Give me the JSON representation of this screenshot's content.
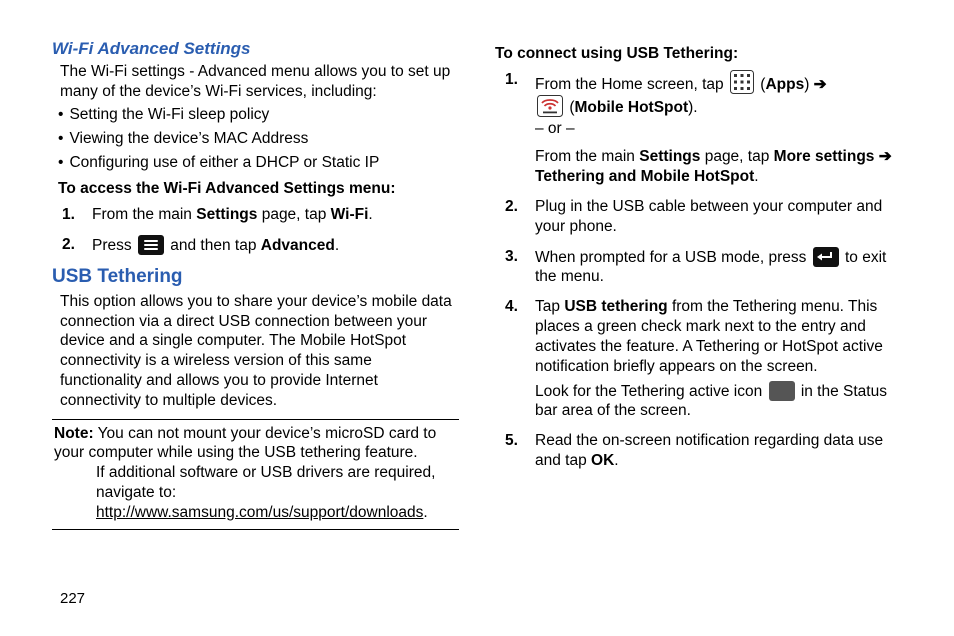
{
  "page_number": "227",
  "left": {
    "heading_wifi": "Wi-Fi Advanced Settings",
    "wifi_intro": "The Wi-Fi settings - Advanced menu allows you to set up many of the device’s Wi-Fi services, including:",
    "wifi_bullets": [
      "Setting the Wi-Fi sleep policy",
      "Viewing the device’s MAC Address",
      "Configuring use of either a DHCP or Static IP"
    ],
    "wifi_access_heading": "To access the Wi-Fi Advanced Settings menu:",
    "wifi_step1_pre": "From the main ",
    "wifi_step1_b1": "Settings",
    "wifi_step1_mid": " page, tap ",
    "wifi_step1_b2": "Wi-Fi",
    "wifi_step1_post": ".",
    "wifi_step2_pre": "Press ",
    "wifi_step2_mid": " and then tap ",
    "wifi_step2_b": "Advanced",
    "wifi_step2_post": ".",
    "heading_usb": "USB Tethering",
    "usb_intro": "This option allows you to share your device’s mobile data connection via a direct USB connection between your device and a single computer. The Mobile HotSpot connectivity is a wireless version of this same functionality and allows you to provide Internet connectivity to multiple devices.",
    "note_label": "Note:",
    "note_line1": " You can not mount your device’s microSD card to your computer while using the USB tethering feature.",
    "note_line2_pre": "If additional software or USB drivers are required, navigate to: ",
    "note_link": "http://www.samsung.com/us/support/downloads",
    "note_line2_post": "."
  },
  "right": {
    "heading": "To connect using USB Tethering:",
    "s1_pre": "From the Home screen, tap ",
    "s1_paren_open": " (",
    "s1_apps": "Apps",
    "s1_paren_close": ") ",
    "s1_arrow": "➔",
    "s1_hotspot_open": " (",
    "s1_hotspot": "Mobile HotSpot",
    "s1_hotspot_close": ").",
    "or_line": "– or –",
    "s1b_pre": "From the main ",
    "s1b_b1": "Settings",
    "s1b_mid": " page, tap ",
    "s1b_b2": "More settings ➔ Tethering and Mobile HotSpot",
    "s1b_post": ".",
    "s2": "Plug in the USB cable between your computer and your phone.",
    "s3_pre": "When prompted for a USB mode, press ",
    "s3_post": " to exit the menu.",
    "s4_pre": "Tap ",
    "s4_b": "USB tethering",
    "s4_mid": " from the Tethering menu. This places a green check mark next to the entry and activates the feature. A Tethering or HotSpot active notification briefly appears on the screen.",
    "s4_look_pre": "Look for the Tethering active icon ",
    "s4_look_post": " in the Status bar area of the screen.",
    "s5_pre": "Read the on-screen notification regarding data use and tap ",
    "s5_b": "OK",
    "s5_post": "."
  }
}
